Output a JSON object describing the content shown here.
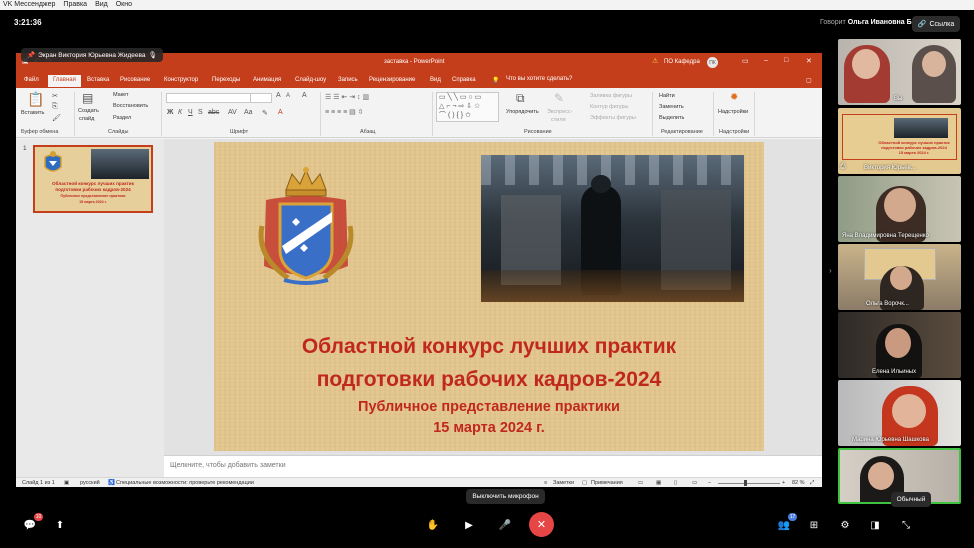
{
  "vk": {
    "menu": [
      "VK Мессенджер",
      "Правка",
      "Вид",
      "Окно"
    ],
    "call_time": "3:21:36",
    "speaker_prefix": "Говорит",
    "speaker_name": "Ольга Ивановна Б.",
    "link_label": "Ссылка",
    "share_label": "Экран Виктория Юрьевна Жидеева",
    "mic_tooltip": "Выключить микрофон",
    "view_tooltip": "Обычный",
    "chat_badge": "10",
    "participants_badge": "17"
  },
  "ppt": {
    "window_title": "заставка - PowerPoint",
    "user": "ПО Кафедра",
    "avatar": "ПК",
    "tabs": [
      "Файл",
      "Главная",
      "Вставка",
      "Рисование",
      "Конструктор",
      "Переходы",
      "Анимация",
      "Слайд-шоу",
      "Запись",
      "Рецензирование",
      "Вид",
      "Справка"
    ],
    "tell_me": "Что вы хотите сделать?",
    "ribbon": {
      "paste": "Вставить",
      "clipboard": "Буфер обмена",
      "new_slide_1": "Создать",
      "new_slide_2": "слайд",
      "layout": "Макет",
      "reset": "Восстановить",
      "section": "Раздел",
      "slides": "Слайды",
      "font": "Шрифт",
      "paragraph": "Абзац",
      "arrange": "Упорядочить",
      "quick_styles_1": "Экспресс-",
      "quick_styles_2": "стили",
      "shape_fill": "Заливка фигуры",
      "shape_outline": "Контур фигуры",
      "shape_effects": "Эффекты фигуры",
      "drawing": "Рисование",
      "find": "Найти",
      "replace": "Заменить",
      "select": "Выделить",
      "editing": "Редактирование",
      "addins": "Надстройки",
      "addins_group": "Надстройки"
    },
    "thumb_number": "1",
    "thumb_text": [
      "Областной конкурс лучших практик",
      "подготовки рабочих кадров-2024",
      "Публичное представление практики",
      "15 марта 2024 г."
    ],
    "slide": {
      "title_line1": "Областной конкурс лучших практик",
      "title_line2": "подготовки рабочих кадров-2024",
      "subtitle_line1": "Публичное представление практики",
      "subtitle_line2": "15 марта 2024 г."
    },
    "notes_placeholder": "Щелкните, чтобы добавить заметки",
    "status": {
      "slide_of": "Слайд 1 из 1",
      "language": "русский",
      "accessibility": "Специальные возможности: проверьте рекомендации",
      "notes": "Заметки",
      "comments": "Примечания",
      "zoom": "82 %"
    }
  },
  "participants": [
    {
      "name": "Вы"
    },
    {
      "name": "Виктория Юрьев..."
    },
    {
      "name": "Яна Владимировна Терещенко"
    },
    {
      "name": "Ольга Ворочк..."
    },
    {
      "name": "Елена Ильиных"
    },
    {
      "name": "Марина Юрьевна Шашкова"
    },
    {
      "name": ""
    }
  ],
  "colors": {
    "ppt_accent": "#c43e1c",
    "slide_text": "#c0281e",
    "end_call": "#e64646"
  }
}
